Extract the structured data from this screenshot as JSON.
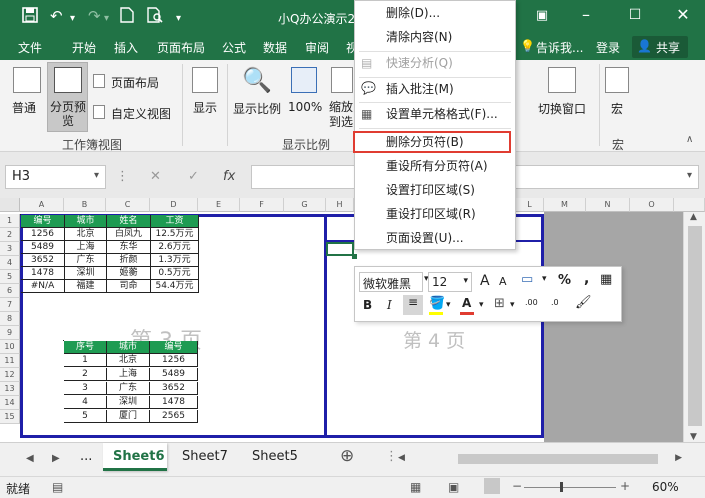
{
  "title": "小Q办公演示2",
  "tabs": [
    "文件",
    "开始",
    "插入",
    "页面布局",
    "公式",
    "数据",
    "审阅",
    "视"
  ],
  "tell_me": "告诉我...",
  "login": "登录",
  "share": "共享",
  "ribbon": {
    "normal": "普通",
    "page_break": "分页预览",
    "page_layout": "页面布局",
    "custom_view": "自定义视图",
    "group_views": "工作簿视图",
    "show": "显示",
    "zoom": "显示比例",
    "zoom100": "100%",
    "zoom_sel": "缩放到选定区域",
    "group_zoom": "显示比例",
    "switch_window": "切换窗口",
    "macros": "宏",
    "group_macros": "宏"
  },
  "namebox": "H3",
  "fx": "fx",
  "cols": [
    "A",
    "B",
    "C",
    "D",
    "E",
    "F",
    "G",
    "H",
    "I",
    "J",
    "K",
    "L",
    "M",
    "N",
    "O"
  ],
  "rows": [
    "1",
    "2",
    "3",
    "4",
    "5",
    "6",
    "7",
    "8",
    "9",
    "10",
    "11",
    "12",
    "13",
    "14",
    "15"
  ],
  "table1": {
    "headers": [
      "编号",
      "城市",
      "姓名",
      "工资"
    ],
    "rows": [
      [
        "1256",
        "北京",
        "白凤九",
        "12.5万元"
      ],
      [
        "5489",
        "上海",
        "东华",
        "2.6万元"
      ],
      [
        "3652",
        "广东",
        "折颜",
        "1.3万元"
      ],
      [
        "1478",
        "深圳",
        "姬蘅",
        "0.5万元"
      ],
      [
        "#N/A",
        "福建",
        "司命",
        "54.4万元"
      ]
    ]
  },
  "table2": {
    "headers": [
      "序号",
      "城市",
      "编号"
    ],
    "rows": [
      [
        "1",
        "北京",
        "1256"
      ],
      [
        "2",
        "上海",
        "5489"
      ],
      [
        "3",
        "广东",
        "3652"
      ],
      [
        "4",
        "深圳",
        "1478"
      ],
      [
        "5",
        "厦门",
        "2565"
      ]
    ]
  },
  "watermarks": {
    "page3": "第 3 页",
    "page4": "第 4 页"
  },
  "context_menu": [
    "删除(D)...",
    "清除内容(N)",
    "快速分析(Q)",
    "插入批注(M)",
    "设置单元格格式(F)...",
    "删除分页符(B)",
    "重设所有分页符(A)",
    "设置打印区域(S)",
    "重设打印区域(R)",
    "页面设置(U)..."
  ],
  "mini_toolbar": {
    "font": "微软雅黑",
    "size": "12",
    "percent": "%",
    "comma": ","
  },
  "sheets": [
    "...",
    "Sheet6",
    "Sheet7",
    "Sheet5"
  ],
  "status": {
    "ready": "就绪",
    "zoom": "60%"
  },
  "colors": {
    "excel_green": "#217346",
    "highlight": "#e03c31"
  }
}
